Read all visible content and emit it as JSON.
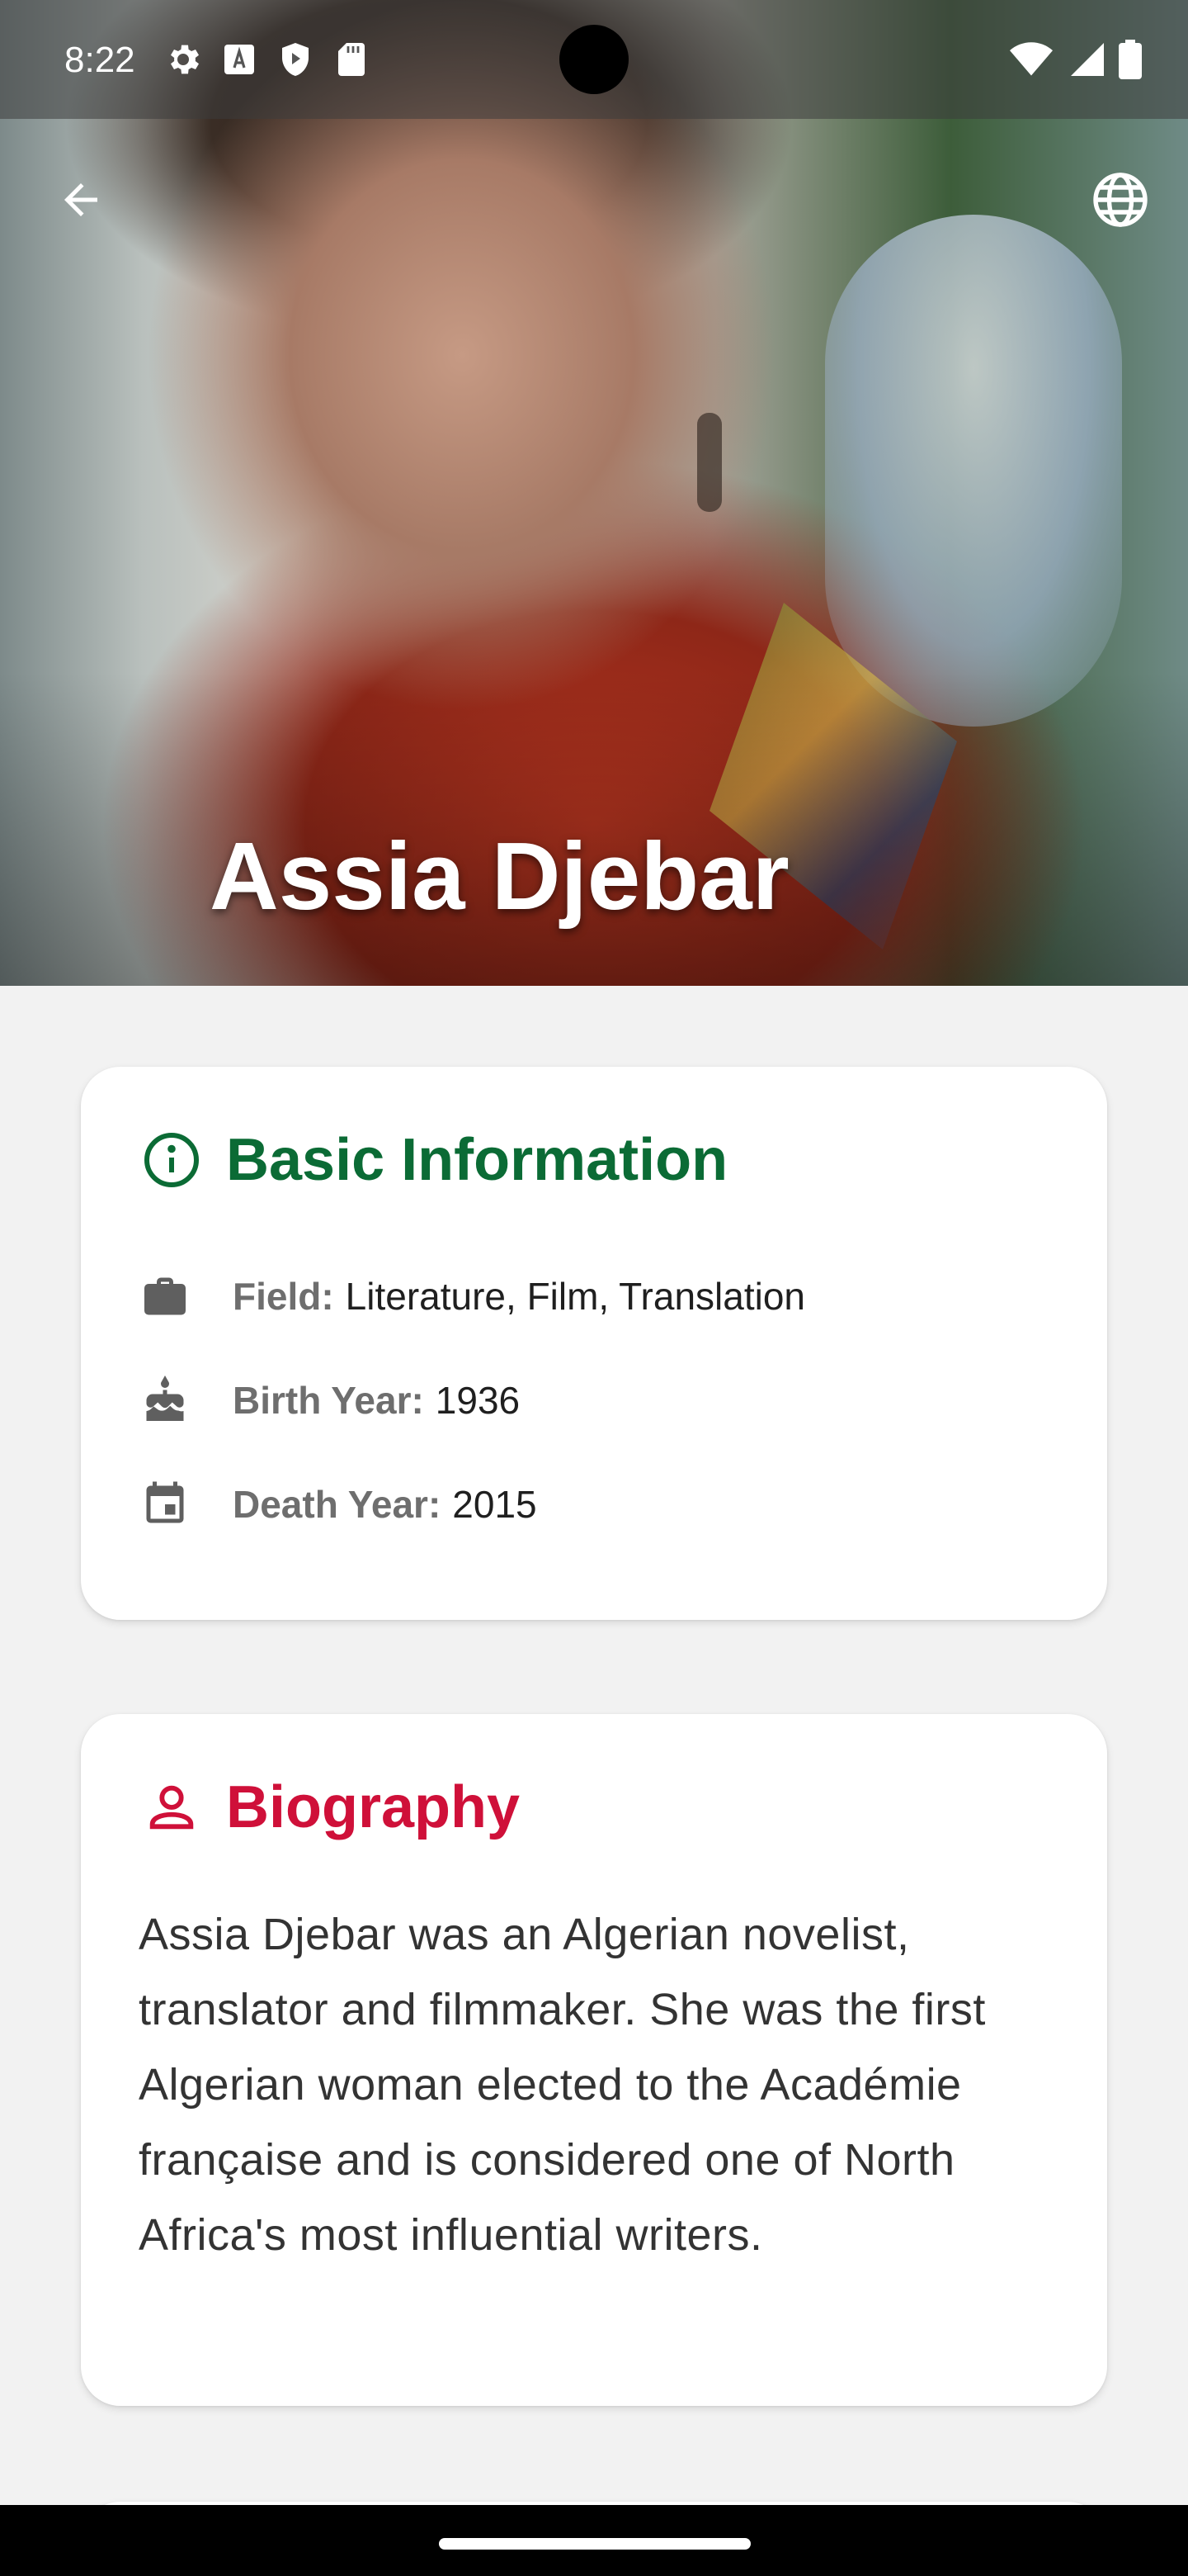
{
  "status_bar": {
    "time": "8:22",
    "left_icons": [
      "gear-icon",
      "font-a-icon",
      "shield-play-icon",
      "sd-card-icon"
    ],
    "right_icons": [
      "wifi-icon",
      "signal-icon",
      "battery-icon"
    ]
  },
  "app_bar": {
    "back_icon": "arrow-back-icon",
    "language_icon": "globe-icon"
  },
  "hero": {
    "name": "Assia Djebar"
  },
  "basic_info": {
    "title": "Basic Information",
    "title_color": "#0b6b35",
    "icon": "info-circle-icon",
    "rows": [
      {
        "icon": "briefcase-icon",
        "label": "Field:",
        "value": "Literature, Film, Translation"
      },
      {
        "icon": "cake-icon",
        "label": "Birth Year:",
        "value": "1936"
      },
      {
        "icon": "calendar-icon",
        "label": "Death Year:",
        "value": "2015"
      }
    ]
  },
  "biography": {
    "title": "Biography",
    "title_color": "#cf1039",
    "icon": "person-icon",
    "text": "Assia Djebar was an Algerian novelist, translator and filmmaker. She was the first Algerian woman elected to the Académie française and is considered one of North Africa's most influential writers."
  }
}
